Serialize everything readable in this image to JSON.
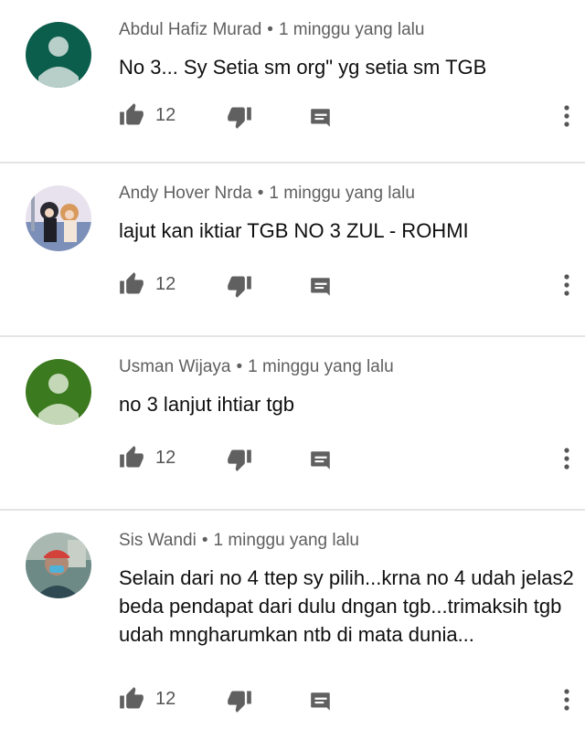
{
  "comments": [
    {
      "author": "Abdul Hafiz Murad",
      "time": "1 minggu yang lalu",
      "text": "No 3... Sy Setia sm org\" yg setia sm TGB",
      "likes": "12",
      "avatar_color": "#0b5d4c",
      "avatar_icon": "default-person-avatar"
    },
    {
      "author": "Andy Hover Nrda",
      "time": "1 minggu yang lalu",
      "text": "lajut kan iktiar TGB  NO 3 ZUL - ROHMI",
      "likes": "12",
      "avatar_icon": "anime-photo-avatar"
    },
    {
      "author": "Usman Wijaya",
      "time": "1 minggu yang lalu",
      "text": "no 3 lanjut ihtiar tgb",
      "likes": "12",
      "avatar_color": "#3b7a1e",
      "avatar_icon": "default-person-avatar"
    },
    {
      "author": "Sis Wandi",
      "time": "1 minggu yang lalu",
      "text": "Selain dari no 4 ttep sy pilih...krna no 4 udah jelas2 beda pendapat dari dulu dngan tgb...trimaksih tgb udah mngharumkan ntb di mata dunia...",
      "likes": "12",
      "avatar_icon": "photo-avatar"
    }
  ],
  "icons": {
    "like": "thumb-up-icon",
    "dislike": "thumb-down-icon",
    "reply": "reply-comment-icon",
    "more": "more-vertical-icon"
  },
  "separator": "•"
}
